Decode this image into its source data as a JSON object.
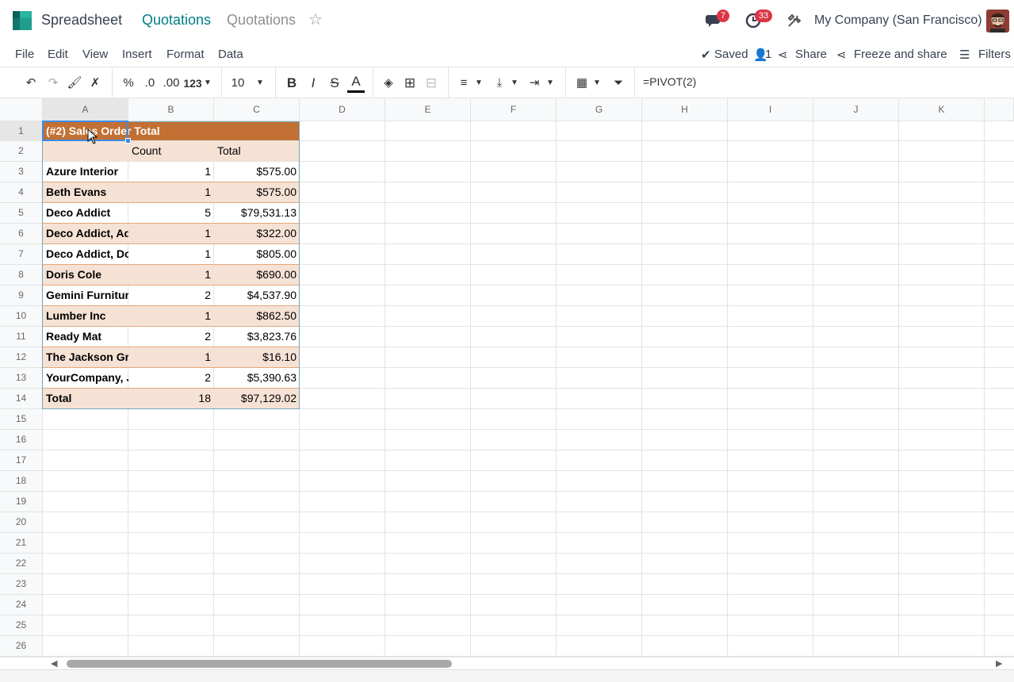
{
  "header": {
    "app_title": "Spreadsheet",
    "breadcrumb_1": "Quotations",
    "breadcrumb_2": "Quotations",
    "messages_count": "7",
    "activities_count": "33",
    "company": "My Company (San Francisco)"
  },
  "menu": {
    "file": "File",
    "edit": "Edit",
    "view": "View",
    "insert": "Insert",
    "format": "Format",
    "data": "Data",
    "saved": "Saved",
    "users": "1",
    "share": "Share",
    "freeze_share": "Freeze and share",
    "filters": "Filters"
  },
  "toolbar": {
    "percent": "%",
    "dec_decrease": ".0",
    "dec_increase": ".00",
    "number_format": "123",
    "font_size": "10",
    "bold": "B",
    "italic": "I",
    "strike": "S",
    "text_color": "A",
    "formula": "=PIVOT(2)"
  },
  "columns": [
    "A",
    "B",
    "C",
    "D",
    "E",
    "F",
    "G",
    "H",
    "I",
    "J",
    "K"
  ],
  "rows": [
    "1",
    "2",
    "3",
    "4",
    "5",
    "6",
    "7",
    "8",
    "9",
    "10",
    "11",
    "12",
    "13",
    "14",
    "15",
    "16",
    "17",
    "18",
    "19",
    "20",
    "21",
    "22",
    "23",
    "24",
    "25",
    "26"
  ],
  "pivot": {
    "title": "(#2) Sales Order Total",
    "header_count": "Count",
    "header_total": "Total",
    "rows": [
      {
        "name": "Azure Interior",
        "count": "1",
        "total": "$575.00"
      },
      {
        "name": "Beth Evans",
        "count": "1",
        "total": "$575.00"
      },
      {
        "name": "Deco Addict",
        "count": "5",
        "total": "$79,531.13"
      },
      {
        "name": "Deco Addict, Ad",
        "count": "1",
        "total": "$322.00"
      },
      {
        "name": "Deco Addict, Do",
        "count": "1",
        "total": "$805.00"
      },
      {
        "name": "Doris Cole",
        "count": "1",
        "total": "$690.00"
      },
      {
        "name": "Gemini Furniture",
        "count": "2",
        "total": "$4,537.90"
      },
      {
        "name": "Lumber Inc",
        "count": "1",
        "total": "$862.50"
      },
      {
        "name": "Ready Mat",
        "count": "2",
        "total": "$3,823.76"
      },
      {
        "name": "The Jackson Gr",
        "count": "1",
        "total": "$16.10"
      },
      {
        "name": "YourCompany, J",
        "count": "2",
        "total": "$5,390.63"
      },
      {
        "name": "Total",
        "count": "18",
        "total": "$97,129.02"
      }
    ]
  },
  "colors": {
    "accent": "#017e84",
    "pivot_header": "#c27034",
    "pivot_band": "#f6e2d5",
    "badge": "#dc3545"
  }
}
